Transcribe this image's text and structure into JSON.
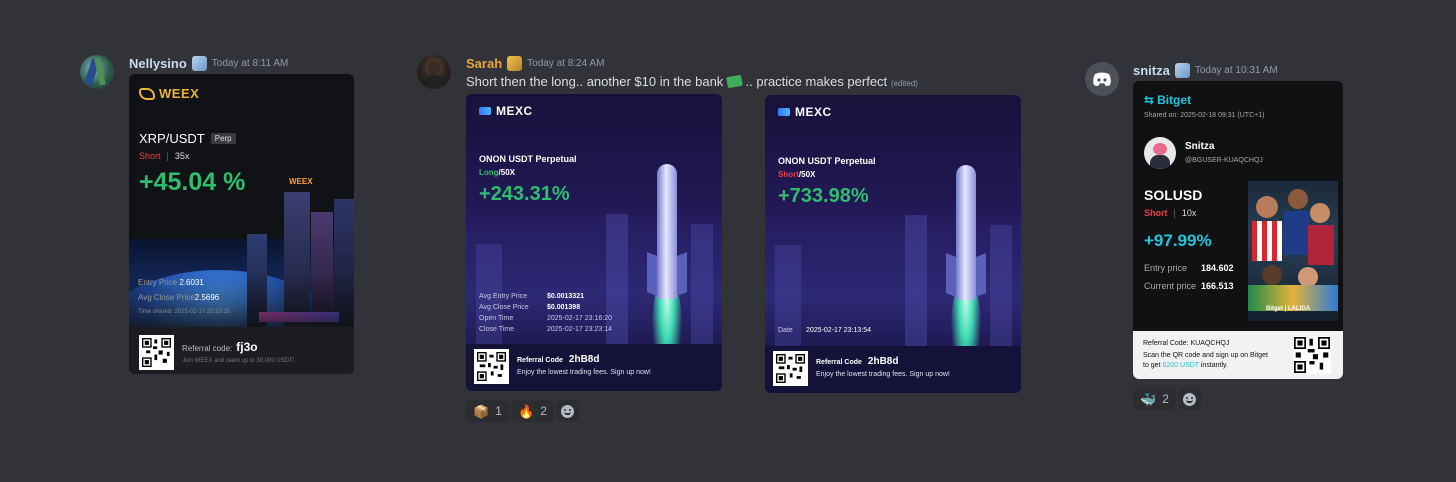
{
  "messages": [
    {
      "username": "Nellysino",
      "timestamp": "Today at 8:11 AM",
      "card": {
        "brand": "WEEX",
        "pair": "XRP/USDT",
        "tag": "Perp",
        "direction": "Short",
        "separator": "|",
        "leverage": "35x",
        "pnl": "+45.04 %",
        "sign_text": "WEEX",
        "entry_label": "Entry Price",
        "entry_value": "2.6031",
        "close_label": "Avg Close Price",
        "close_value": "2.5696",
        "time_shared": "Time shared: 2025-02-17 22:10:35",
        "referral_label": "Referral code:",
        "referral_code": "fj3o",
        "claim_text": "Join WEEX and claim up to 30,000 USDT!"
      }
    },
    {
      "username": "Sarah",
      "timestamp": "Today at 8:24 AM",
      "text": "Short then the long.. another $10 in the bank",
      "text_after": ".. practice makes perfect",
      "edited": "(edited)",
      "card1": {
        "brand": "MEXC",
        "title": "ONON USDT Perpetual",
        "direction": "Long",
        "leverage": "/50X",
        "pnl": "+243.31%",
        "rows": [
          {
            "label": "Avg Entry Price",
            "value": "$0.0013321"
          },
          {
            "label": "Avg Close Price",
            "value": "$0.001398"
          },
          {
            "label": "Open Time",
            "value": "2025-02-17 23:16:20"
          },
          {
            "label": "Close Time",
            "value": "2025-02-17 23:23:14"
          }
        ],
        "referral_label": "Referral Code",
        "referral_code": "2hB8d",
        "tagline": "Enjoy the lowest trading fees. Sign up now!"
      },
      "card2": {
        "brand": "MEXC",
        "title": "ONON USDT Perpetual",
        "direction": "Short",
        "leverage": "/50X",
        "pnl": "+733.98%",
        "date_label": "Date",
        "date_value": "2025-02-17 23:13:54",
        "referral_label": "Referral Code",
        "referral_code": "2hB8d",
        "tagline": "Enjoy the lowest trading fees. Sign up now!"
      },
      "reactions": [
        {
          "emoji": "📦",
          "count": "1"
        },
        {
          "emoji": "🔥",
          "count": "2"
        }
      ]
    },
    {
      "username": "snitza",
      "timestamp": "Today at 10:31 AM",
      "card": {
        "brand": "Bitget",
        "shared_on": "Shared on: 2025-02-18 09:31 (UTC+1)",
        "name": "Snitza",
        "handle": "@BGUSER-KUAQCHQJ",
        "pair": "SOLUSD",
        "direction": "Short",
        "separator": "|",
        "leverage": "10x",
        "pnl": "+97.99%",
        "entry_label": "Entry price",
        "entry_value": "184.602",
        "current_label": "Current price",
        "current_value": "166.513",
        "partner": "Bitget | LALIGA",
        "referral": "Referral Code: KUAQCHQJ",
        "scan_1": "Scan the QR code and sign up on Bitget",
        "scan_2a": "to get",
        "scan_amount": "6200 USDT",
        "scan_2b": "instantly."
      },
      "reactions": [
        {
          "emoji": "🐳",
          "count": "2"
        }
      ]
    }
  ],
  "colors": {
    "green": "#2ebd6f",
    "red": "#e5404a",
    "bitget_cyan": "#1ec8dc",
    "weex_gold": "#e8b33a",
    "sarah_name": "#e8a53c",
    "name_blue": "#c9d9ee"
  },
  "icons": {
    "add_reaction": "smiley-plus-icon",
    "badge": "snowflake-badge-icon",
    "discord_default": "discord-logo-icon"
  }
}
